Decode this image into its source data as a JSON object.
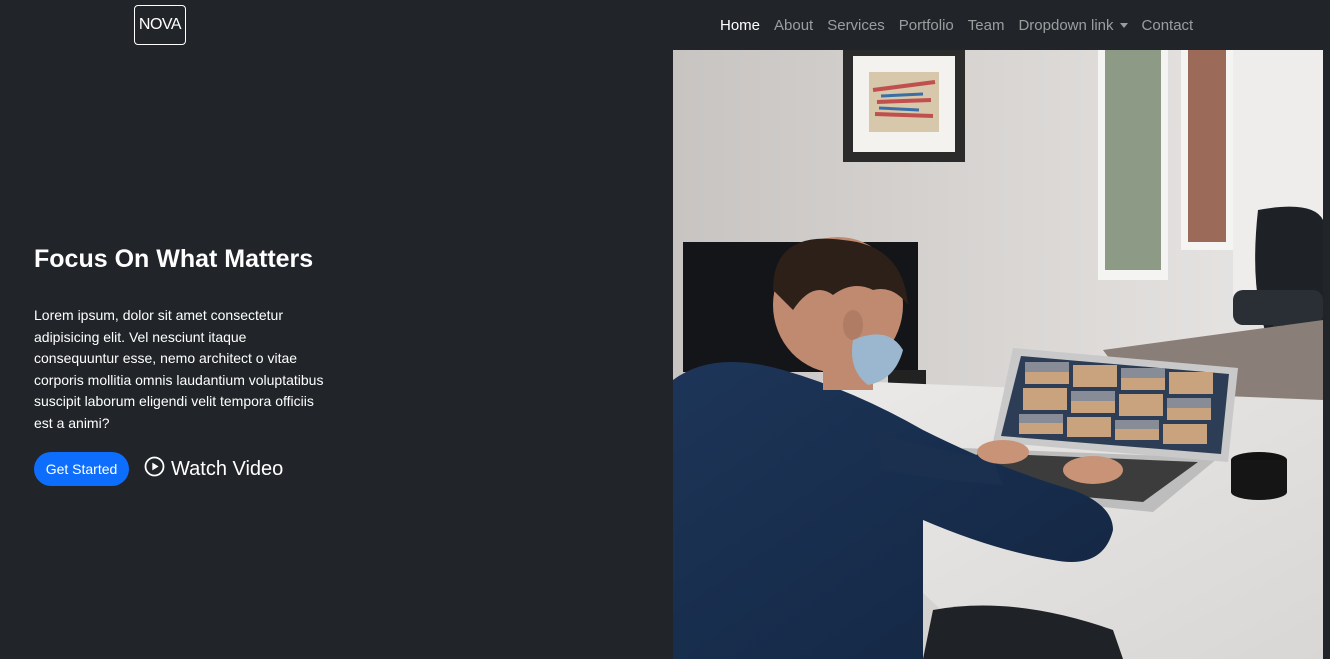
{
  "brand": {
    "logo_text": "NOVA"
  },
  "nav": {
    "items": [
      {
        "label": "Home",
        "active": true
      },
      {
        "label": "About",
        "active": false
      },
      {
        "label": "Services",
        "active": false
      },
      {
        "label": "Portfolio",
        "active": false
      },
      {
        "label": "Team",
        "active": false
      },
      {
        "label": "Dropdown link",
        "active": false,
        "dropdown": true
      },
      {
        "label": "Contact",
        "active": false
      }
    ]
  },
  "hero": {
    "title": "Focus On What Matters",
    "description": "Lorem ipsum, dolor sit amet consectetur adipisicing elit. Vel nesciunt itaque consequuntur esse, nemo architect o vitae corporis mollitia omnis laudantium voluptatibus suscipit laborum eligendi velit tempora officiis est a animi?",
    "primary_button": "Get Started",
    "video_link": "Watch Video",
    "video_icon": "play-circle-icon"
  },
  "colors": {
    "background": "#212529",
    "accent": "#0d6efd",
    "text": "#ffffff"
  }
}
